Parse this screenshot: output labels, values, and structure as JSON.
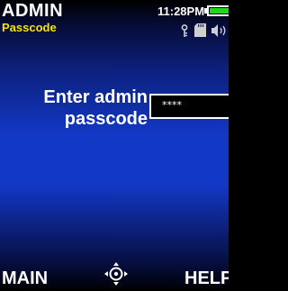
{
  "header": {
    "title": "ADMIN",
    "subtitle": "Passcode",
    "time": "11:28PM",
    "status_icons": [
      "key-icon",
      "sd-card-icon",
      "speaker-icon",
      "battery-icon"
    ]
  },
  "main": {
    "prompt_line1": "Enter admin",
    "prompt_line2": "passcode",
    "passcode_value": "****"
  },
  "softkeys": {
    "left_label": "MAIN",
    "center_icon": "navigation-pad-icon",
    "right_label": "HELP"
  },
  "colors": {
    "accent_yellow": "#f5e400",
    "battery_green": "#22d81e",
    "background_blue": "#1238c6",
    "text": "#ffffff"
  }
}
